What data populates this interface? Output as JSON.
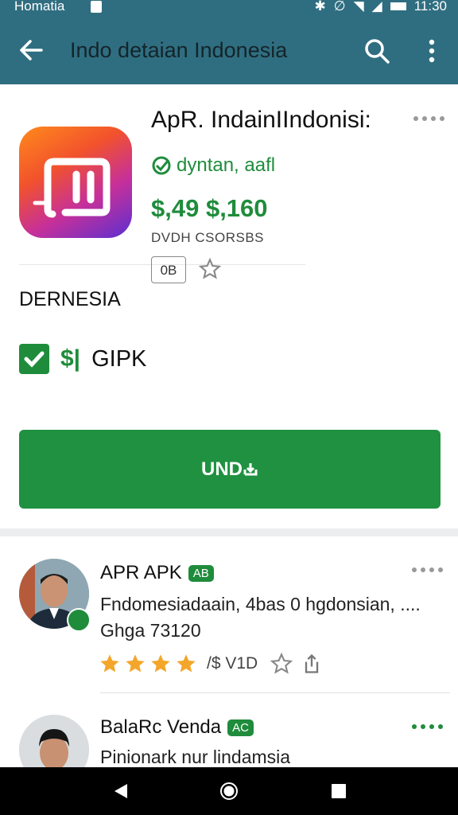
{
  "status_bar": {
    "carrier": "Homatia",
    "time": "11:30"
  },
  "app_bar": {
    "title": "Indo detaian Indonesia"
  },
  "app": {
    "name": "ApR. IndainIIndonisi:",
    "developer": "dyntan, aafl",
    "price": "$,49 $,160",
    "subline": "DVDH CSORSBS",
    "rating_badge": "0B",
    "section_label": "DERNESIA",
    "feature_symbol": "$|",
    "feature_label": "GIPK",
    "install_label": "UND"
  },
  "reviews": [
    {
      "name": "APR APK",
      "badge": "AB",
      "text_line1": "Fndomesiadaain, 4bas 0  hgdonsian, ....",
      "text_line2": "Ghga 73120",
      "stars": 4,
      "meta": "/$   V1D"
    },
    {
      "name": "BalaRc Venda",
      "badge": "AC",
      "text_line1": "Pinionark nur lindamsia"
    }
  ],
  "colors": {
    "appbar": "#2f6e80",
    "accent": "#1f8c3c",
    "star": "#f3a62a"
  },
  "icons": [
    "back-arrow-icon",
    "search-icon",
    "more-vert-icon",
    "verified-icon",
    "star-icon",
    "share-icon",
    "nav-back-icon",
    "nav-home-icon",
    "nav-recents-icon"
  ]
}
